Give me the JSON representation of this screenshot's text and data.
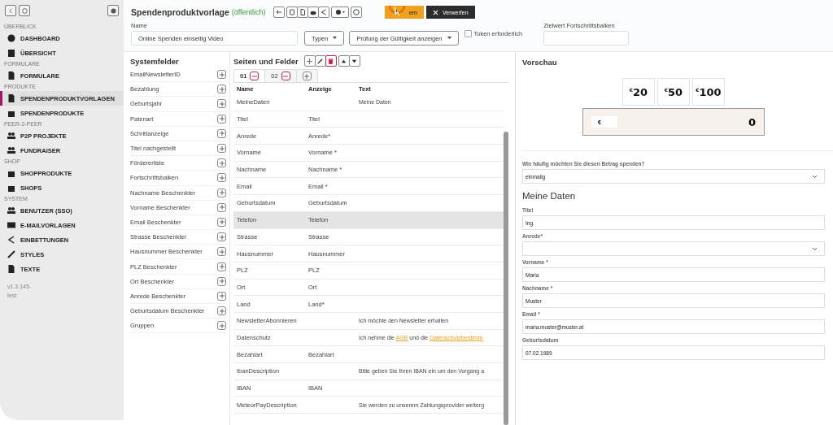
{
  "sidebar": {
    "version": "v1.3.145-test",
    "sections": [
      {
        "title": "ÜBERBLICK",
        "items": [
          {
            "label": "DASHBOARD",
            "selected": false
          },
          {
            "label": "ÜBERSICHT",
            "selected": false
          }
        ]
      },
      {
        "title": "FORMULARE",
        "items": [
          {
            "label": "FORMULARE",
            "selected": false
          }
        ]
      },
      {
        "title": "PRODUKTE",
        "items": [
          {
            "label": "SPENDENPRODUKTVORLAGEN",
            "selected": true
          },
          {
            "label": "SPENDENPRODUKTE",
            "selected": false
          }
        ]
      },
      {
        "title": "PEER-2-PEER",
        "items": [
          {
            "label": "P2P PROJEKTE",
            "selected": false
          },
          {
            "label": "FUNDRAISER",
            "selected": false
          }
        ]
      },
      {
        "title": "SHOP",
        "items": [
          {
            "label": "SHOPPRODUKTE",
            "selected": false
          },
          {
            "label": "SHOPS",
            "selected": false
          }
        ]
      },
      {
        "title": "SYSTEM",
        "items": [
          {
            "label": "BENUTZER (SSO)",
            "selected": false
          },
          {
            "label": "E-MAILVORLAGEN",
            "selected": false
          },
          {
            "label": "EINBETTUNGEN",
            "selected": false
          },
          {
            "label": "STYLES",
            "selected": false
          },
          {
            "label": "TEXTE",
            "selected": false
          }
        ]
      }
    ]
  },
  "header": {
    "title": "Spendenproduktvorlage",
    "status": "(öffentlich)",
    "save_label": "em",
    "discard_label": "Verwerfen"
  },
  "form": {
    "name_label": "Name",
    "name_value": "Online Spenden einseitig Video",
    "types_dropdown": "Typen",
    "validation_dropdown": "Prüfung der Gültigkeit anzeigen",
    "token_label": "Token erforderlich",
    "token_checked": false,
    "goal_label": "Zielwert Fortschrittsbalken"
  },
  "system_fields": {
    "title": "Systemfelder",
    "items": [
      "EmailNewsletterID",
      "Bezahlung",
      "Geburtsjahr",
      "Patenart",
      "Schrittanzeige",
      "Titel nachgestellt",
      "Fördererliste",
      "Fortschrittsbalken",
      "Nachname Beschenkter",
      "Vorname Beschenkter",
      "Email Beschenkter",
      "Strasse Beschenkter",
      "Hausnummer Beschenkter",
      "PLZ Beschenkter",
      "Ort Beschenkter",
      "Anrede Beschenkter",
      "Geburtsdatum Beschenkter",
      "Gruppen"
    ]
  },
  "pages": {
    "title": "Seiten und Felder",
    "tabs": [
      {
        "label": "01",
        "selected": true
      },
      {
        "label": "02",
        "selected": false
      }
    ],
    "columns": [
      "Name",
      "Anzeige",
      "Text"
    ],
    "rows": [
      {
        "name": "MeineDaten",
        "text": [
          {
            "kind": "text",
            "t": "Meine Daten"
          }
        ],
        "selected": false
      },
      {
        "name": "Titel",
        "display": "Titel",
        "selected": false
      },
      {
        "name": "Anrede",
        "display": "Anrede*",
        "selected": false
      },
      {
        "name": "Vorname",
        "display": "Vorname *",
        "selected": false
      },
      {
        "name": "Nachname",
        "display": "Nachname *",
        "selected": false
      },
      {
        "name": "Email",
        "display": "Email *",
        "selected": false
      },
      {
        "name": "Geburtsdatum",
        "display": "Geburtsdatum",
        "selected": false
      },
      {
        "name": "Telefon",
        "display": "Telefon",
        "selected": true
      },
      {
        "name": "Strasse",
        "display": "Strasse",
        "selected": false
      },
      {
        "name": "Hausnummer",
        "display": "Hausnummer",
        "selected": false
      },
      {
        "name": "PLZ",
        "display": "PLZ",
        "selected": false
      },
      {
        "name": "Ort",
        "display": "Ort",
        "selected": false
      },
      {
        "name": "Land",
        "display": "Land*",
        "selected": false
      },
      {
        "name": "NewsletterAbonnieren",
        "text": [
          {
            "kind": "text",
            "t": "Ich möchte den Newsletter erhalten"
          }
        ],
        "selected": false
      },
      {
        "name": "Datenschutz",
        "text": [
          {
            "kind": "text",
            "t": "Ich nehme die "
          },
          {
            "kind": "link",
            "t": "AGB"
          },
          {
            "kind": "text",
            "t": " und die "
          },
          {
            "kind": "link",
            "t": "Datenschutzbestimm"
          }
        ],
        "selected": false
      },
      {
        "name": "Bezahlart",
        "display": "Bezahlart",
        "selected": false
      },
      {
        "name": "IbanDescription",
        "text": [
          {
            "kind": "text",
            "t": "Bitte geben Sie Ihren IBAN ein um den Vorgang a"
          }
        ],
        "selected": false
      },
      {
        "name": "IBAN",
        "display": "IBAN",
        "selected": false
      },
      {
        "name": "MeteorPayDescription",
        "text": [
          {
            "kind": "text",
            "t": "Sie werden zu unserem Zahlungsprovider weiterg"
          }
        ],
        "selected": false
      }
    ]
  },
  "preview": {
    "title": "Vorschau",
    "amounts": [
      {
        "currency": "€",
        "value": "20"
      },
      {
        "currency": "€",
        "value": "50"
      },
      {
        "currency": "€",
        "value": "100"
      }
    ],
    "amount_currency": "€",
    "amount_value": "0",
    "frequency_label": "Wie häufig möchten Sie diesen Betrag spenden?",
    "frequency_value": "einmalig",
    "section_title": "Meine Daten",
    "fields": [
      {
        "kind": "input",
        "label": "Titel",
        "value": "Ing."
      },
      {
        "kind": "select",
        "label": "Anrede*"
      },
      {
        "kind": "input",
        "label": "Vorname *",
        "value": "Maria"
      },
      {
        "kind": "input",
        "label": "Nachname *",
        "value": "Muster"
      },
      {
        "kind": "input",
        "label": "Email *",
        "value": "maria.muster@muster.at"
      },
      {
        "kind": "input",
        "label": "Geburtsdatum",
        "value": "07.02.1989"
      }
    ]
  }
}
